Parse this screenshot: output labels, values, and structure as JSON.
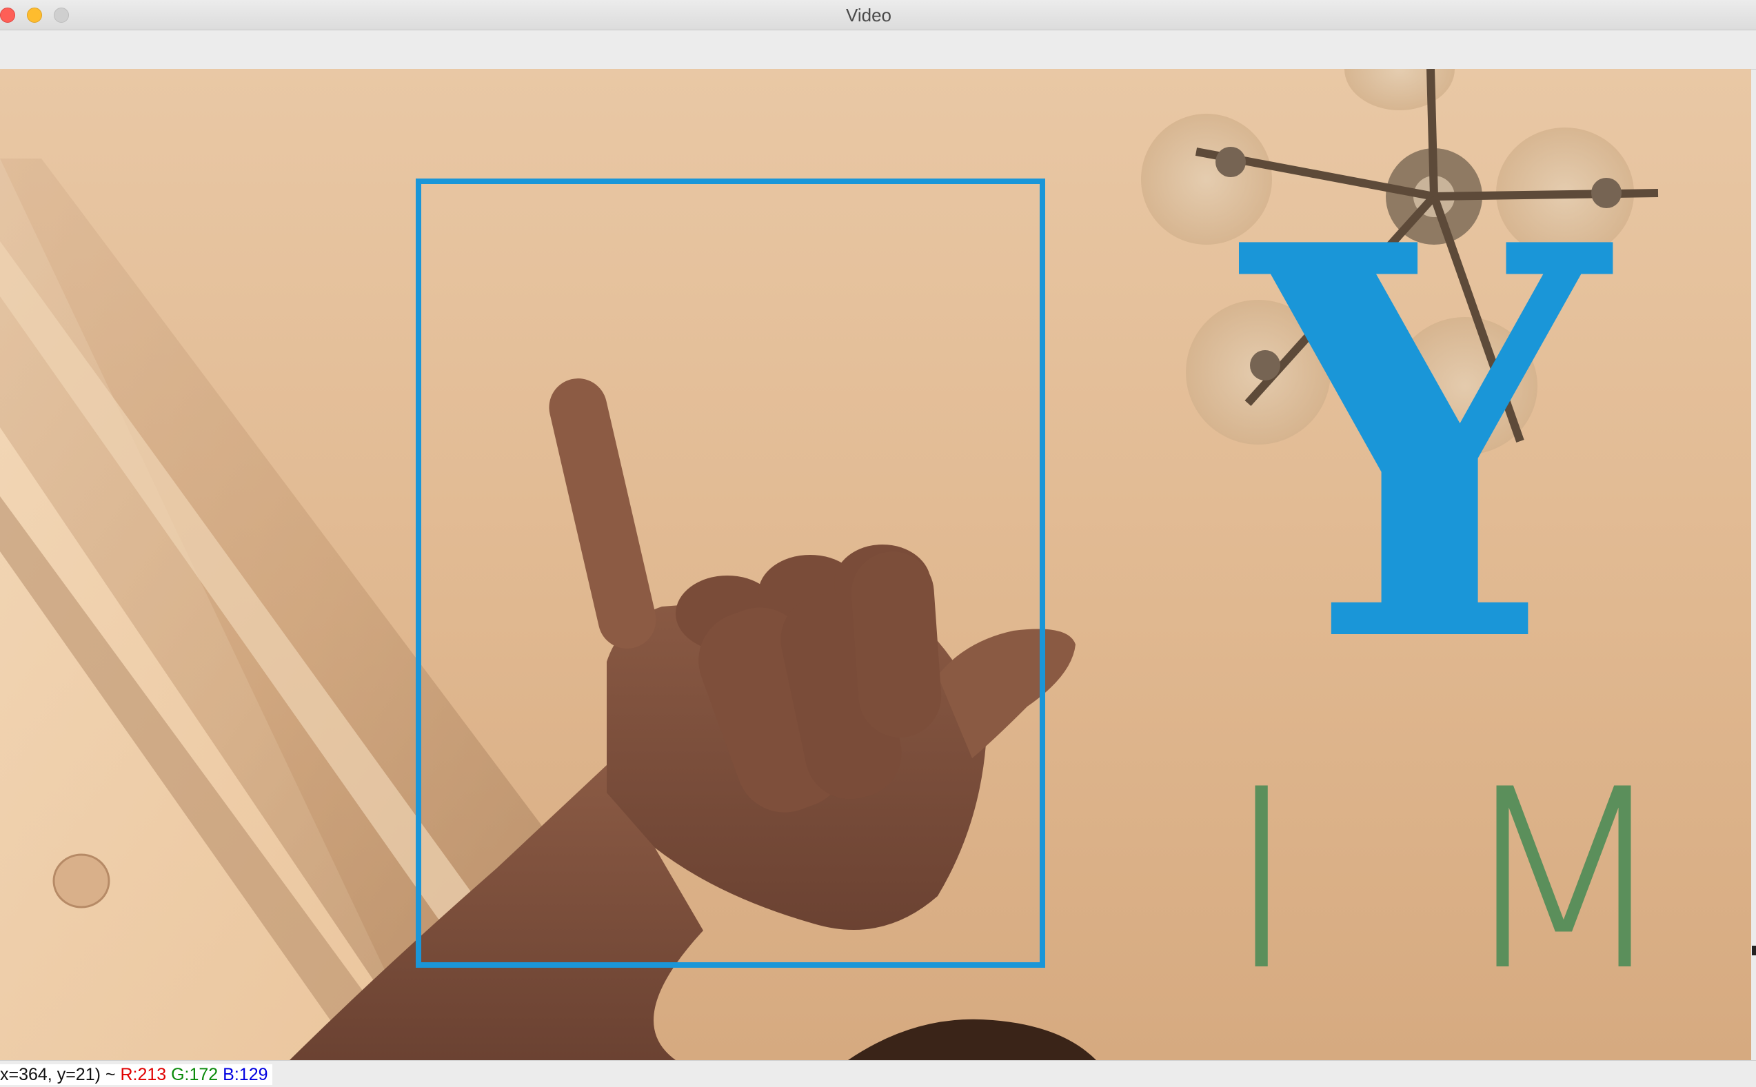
{
  "window": {
    "title": "Video"
  },
  "overlay": {
    "predicted_letter": "Y",
    "history_letters": [
      "I",
      "M"
    ],
    "box_color": "#1a96d8",
    "history_color": "#5b8f5b"
  },
  "status": {
    "coords": "x=364, y=21) ~",
    "r": "R:213",
    "g": "G:172",
    "b": "B:129"
  }
}
